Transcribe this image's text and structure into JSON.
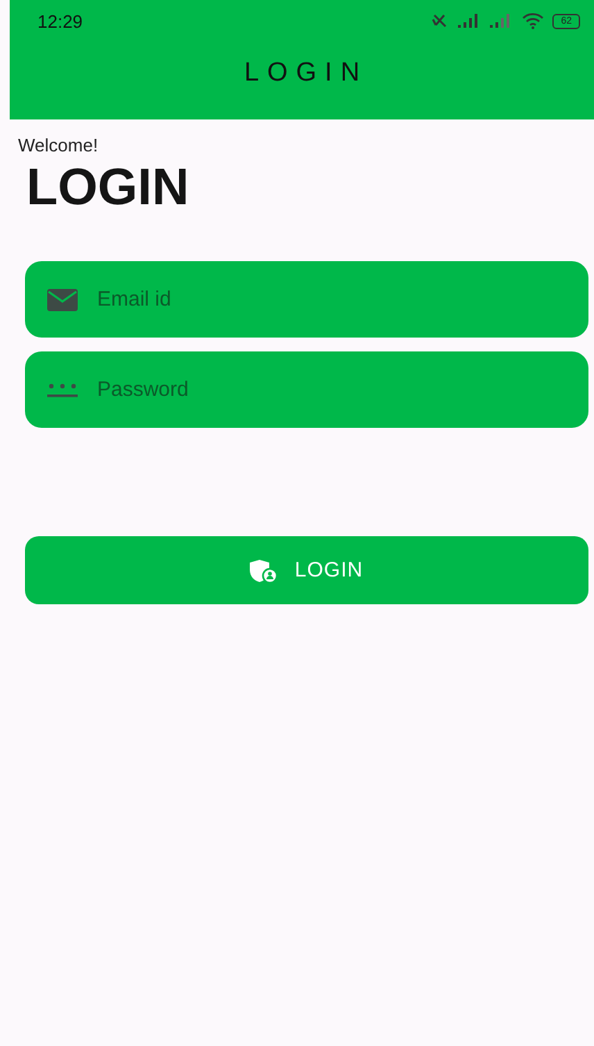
{
  "status_bar": {
    "time": "12:29",
    "battery": "62"
  },
  "app_bar": {
    "title": "LOGIN"
  },
  "greeting": "Welcome!",
  "heading": "LOGIN",
  "fields": [
    {
      "kind": "email",
      "placeholder": "Email id"
    },
    {
      "kind": "password",
      "placeholder": "Password"
    }
  ],
  "login_button": {
    "label": "LOGIN"
  }
}
